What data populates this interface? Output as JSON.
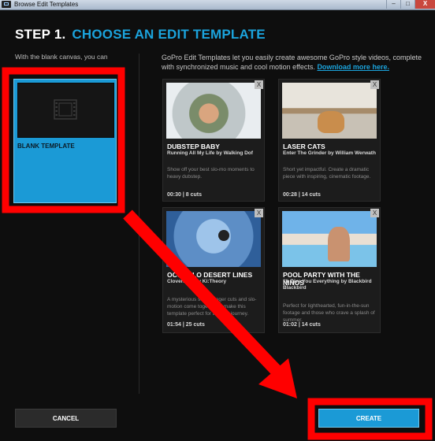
{
  "window": {
    "title": "Browse Edit Templates",
    "minimize": "–",
    "maximize": "□",
    "close": "X"
  },
  "header": {
    "step": "STEP 1.",
    "title": "CHOOSE AN EDIT TEMPLATE"
  },
  "left": {
    "description": "With the blank canvas, you can",
    "blank_label": "BLANK TEMPLATE"
  },
  "right": {
    "description": "GoPro Edit Templates let you easily create awesome GoPro style videos, complete with synchronized music and cool motion effects. ",
    "link": "Download more here."
  },
  "templates": [
    {
      "title": "DUBSTEP BABY",
      "song": "Running All My Life by Walking Dof",
      "desc": "Show off your best slo-mo moments to heavy dubstep.",
      "meta": "00:30  |  8 cuts",
      "close": "X"
    },
    {
      "title": "LASER CATS",
      "song": "Enter The Grinder by William Werwath",
      "desc": "Short yet impactful. Create a dramatic piece with inspiring, cinematic footage.",
      "meta": "00:28  |  14 cuts",
      "close": "X"
    },
    {
      "title": "OCOTILLO DESERT LINES",
      "song": "Cloverland by Ki:Theory",
      "desc": "A mysterious song, longer cuts and slo-motion come together to make this template perfect for an epic journey.",
      "meta": "01:54  |  25 cuts",
      "close": "X"
    },
    {
      "title": "POOL PARTY WITH THE NIÑOS",
      "song": "I'll Give You Everything by Blackbird Blackbird",
      "desc": "Perfect for lighthearted, fun-in-the-sun footage and those who crave a splash of summer.",
      "meta": "01:02  |  14 cuts",
      "close": "X"
    }
  ],
  "footer": {
    "cancel": "CANCEL",
    "create": "CREATE"
  },
  "colors": {
    "accent": "#1ba3dc",
    "annotation": "#ff0000",
    "background": "#0e0e0e"
  }
}
